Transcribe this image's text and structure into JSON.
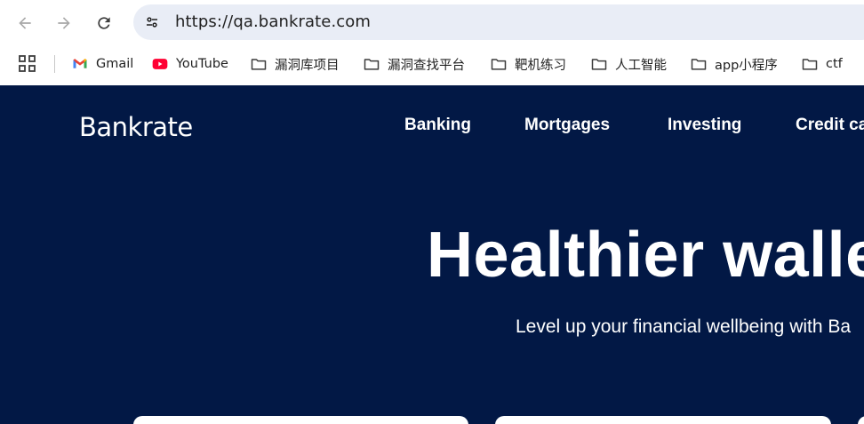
{
  "browser": {
    "url": "https://qa.bankrate.com",
    "icons": {
      "back": "back-arrow-icon",
      "forward": "forward-arrow-icon",
      "reload": "reload-icon",
      "site_info": "tune-icon",
      "apps": "apps-grid-icon"
    },
    "bookmarks": [
      {
        "label": "Gmail",
        "icon": "gmail-icon"
      },
      {
        "label": "YouTube",
        "icon": "youtube-icon"
      },
      {
        "label": "漏洞库项目",
        "icon": "folder-icon"
      },
      {
        "label": "漏洞查找平台",
        "icon": "folder-icon"
      },
      {
        "label": "靶机练习",
        "icon": "folder-icon"
      },
      {
        "label": "人工智能",
        "icon": "folder-icon"
      },
      {
        "label": "app小程序",
        "icon": "folder-icon"
      },
      {
        "label": "ctf",
        "icon": "folder-icon"
      }
    ]
  },
  "site": {
    "logo": "Bankrate",
    "nav": [
      "Banking",
      "Mortgages",
      "Investing",
      "Credit ca"
    ],
    "hero_title": "Healthier wallet",
    "hero_subtitle": "Level up your financial wellbeing with Ba",
    "colors": {
      "background": "#021845",
      "text": "#ffffff",
      "card": "#ffffff"
    }
  }
}
